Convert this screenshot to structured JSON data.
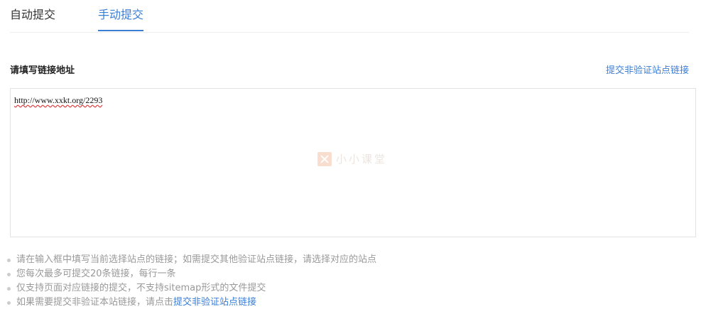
{
  "tabs": [
    {
      "label": "自动提交",
      "active": false
    },
    {
      "label": "手动提交",
      "active": true
    }
  ],
  "form": {
    "title": "请填写链接地址",
    "nonverified_link": "提交非验证站点链接",
    "url_value": "http://www.xxkt.org/2293"
  },
  "watermark": {
    "text": "小小课堂",
    "icon": "x-logo-icon"
  },
  "tips": {
    "items": [
      "请在输入框中填写当前选择站点的链接；如需提交其他验证站点链接，请选择对应的站点",
      "您每次最多可提交20条链接，每行一条",
      "仅支持页面对应链接的提交，不支持sitemap形式的文件提交"
    ],
    "last_prefix": "如果需要提交非验证本站链接，请点击",
    "last_link": "提交非验证站点链接"
  },
  "colors": {
    "accent": "#3b7ed6",
    "tip_text": "#999999",
    "border": "#e3e3e3"
  }
}
